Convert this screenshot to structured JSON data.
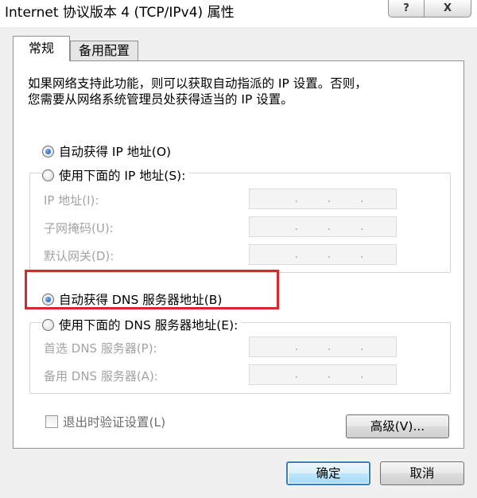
{
  "window": {
    "title": "Internet 协议版本 4 (TCP/IPv4) 属性",
    "help_label": "?",
    "close_label": "X"
  },
  "tabs": [
    {
      "label": "常规",
      "selected": true
    },
    {
      "label": "备用配置",
      "selected": false
    }
  ],
  "description": {
    "line1": "如果网络支持此功能，则可以获取自动指派的 IP 设置。否则，",
    "line2": "您需要从网络系统管理员处获得适当的 IP 设置。"
  },
  "ip_section": {
    "auto_label": "自动获得 IP 地址(O)",
    "manual_label": "使用下面的 IP 地址(S):",
    "selected": "auto",
    "fields": [
      {
        "label": "IP 地址(I):"
      },
      {
        "label": "子网掩码(U):"
      },
      {
        "label": "默认网关(D):"
      }
    ]
  },
  "dns_section": {
    "auto_label": "自动获得 DNS 服务器地址(B)",
    "manual_label": "使用下面的 DNS 服务器地址(E):",
    "selected": "auto",
    "fields": [
      {
        "label": "首选 DNS 服务器(P):"
      },
      {
        "label": "备用 DNS 服务器(A):"
      }
    ]
  },
  "ip_dot": ".",
  "validate_on_exit": {
    "label": "退出时验证设置(L)",
    "checked": false
  },
  "buttons": {
    "advanced": "高级(V)...",
    "ok": "确定",
    "cancel": "取消"
  },
  "colors": {
    "highlight": "#d7282e",
    "disabled_text": "#a3a3a3",
    "default_button_border": "#3c7fb1"
  }
}
